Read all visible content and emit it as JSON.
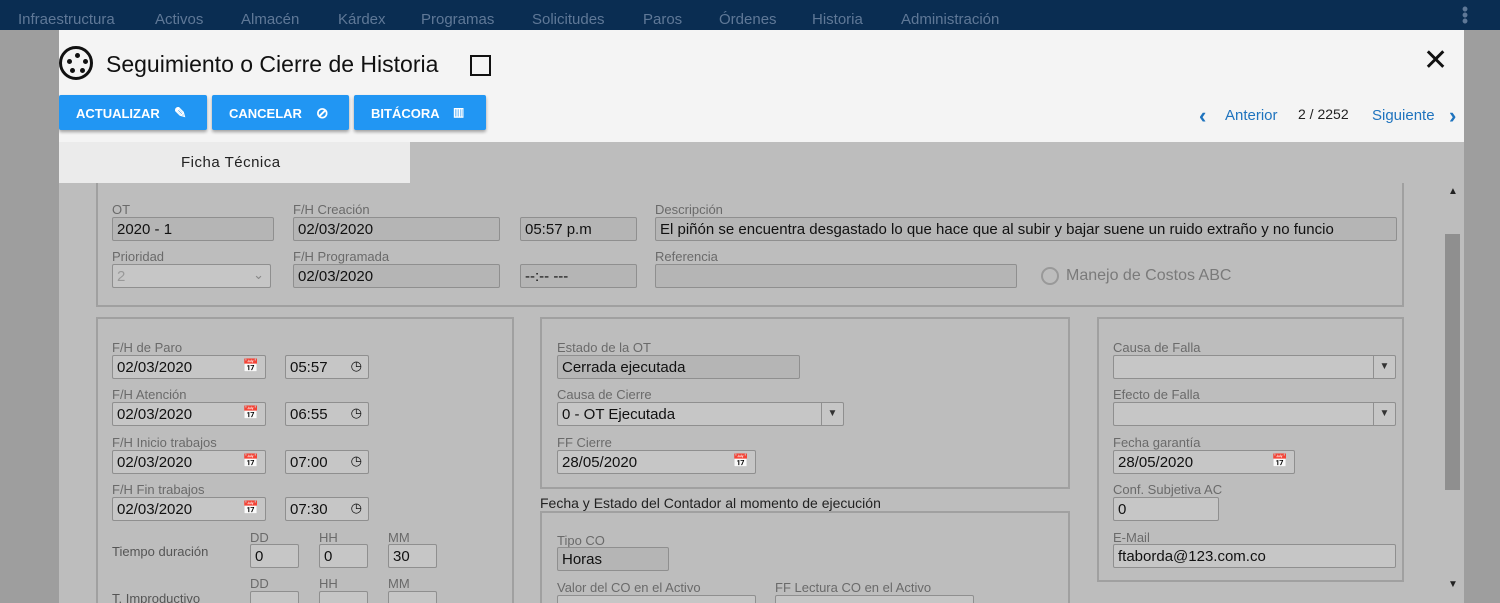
{
  "topnav": {
    "items": [
      "Infraestructura",
      "Activos",
      "Almacén",
      "Kárdex",
      "Programas",
      "Solicitudes",
      "Paros",
      "Órdenes",
      "Historia",
      "Administración"
    ]
  },
  "dialog": {
    "title": "Seguimiento o Cierre de Historia",
    "buttons": {
      "update": "ACTUALIZAR",
      "cancel": "CANCELAR",
      "log": "BITÁCORA"
    },
    "pager": {
      "prev": "Anterior",
      "position": "2 / 2252",
      "next": "Siguiente"
    },
    "tab": "Ficha Técnica"
  },
  "header_panel": {
    "ot_label": "OT",
    "ot_value": "2020 - 1",
    "fh_creacion_label": "F/H Creación",
    "fh_creacion_date": "02/03/2020",
    "fh_creacion_time": "05:57 p.m",
    "descripcion_label": "Descripción",
    "descripcion_value": "El piñón se encuentra desgastado lo que hace que al subir y bajar suene un ruido extraño y no funcio",
    "prioridad_label": "Prioridad",
    "prioridad_value": "2",
    "fh_programada_label": "F/H Programada",
    "fh_programada_date": "02/03/2020",
    "fh_programada_time": "--:-- ---",
    "referencia_label": "Referencia",
    "referencia_value": "",
    "abc_label": "Manejo de Costos ABC"
  },
  "times_panel": {
    "paro_label": "F/H de Paro",
    "paro_date": "02/03/2020",
    "paro_time": "05:57",
    "atencion_label": "F/H Atención",
    "atencion_date": "02/03/2020",
    "atencion_time": "06:55",
    "inicio_label": "F/H Inicio trabajos",
    "inicio_date": "02/03/2020",
    "inicio_time": "07:00",
    "fin_label": "F/H Fin trabajos",
    "fin_date": "02/03/2020",
    "fin_time": "07:30",
    "dd_label": "DD",
    "hh_label": "HH",
    "mm_label": "MM",
    "duracion_label": "Tiempo duración",
    "duracion_dd": "0",
    "duracion_hh": "0",
    "duracion_mm": "30",
    "improductivo_label": "T. Improductivo"
  },
  "status_panel": {
    "estado_label": "Estado de la OT",
    "estado_value": "Cerrada ejecutada",
    "causa_cierre_label": "Causa de Cierre",
    "causa_cierre_value": "0 - OT Ejecutada",
    "ff_cierre_label": "FF Cierre",
    "ff_cierre_value": "28/05/2020"
  },
  "counter_section": {
    "heading": "Fecha y Estado del Contador al momento de ejecución",
    "tipo_label": "Tipo CO",
    "tipo_value": "Horas",
    "valor_label": "Valor del CO en el Activo",
    "ff_lectura_label": "FF Lectura CO en el Activo"
  },
  "failure_panel": {
    "causa_falla_label": "Causa de Falla",
    "causa_falla_value": "",
    "efecto_falla_label": "Efecto de Falla",
    "efecto_falla_value": "",
    "garantia_label": "Fecha garantía",
    "garantia_value": "28/05/2020",
    "conf_label": "Conf. Subjetiva AC",
    "conf_value": "0",
    "email_label": "E-Mail",
    "email_value": "ftaborda@123.com.co"
  }
}
